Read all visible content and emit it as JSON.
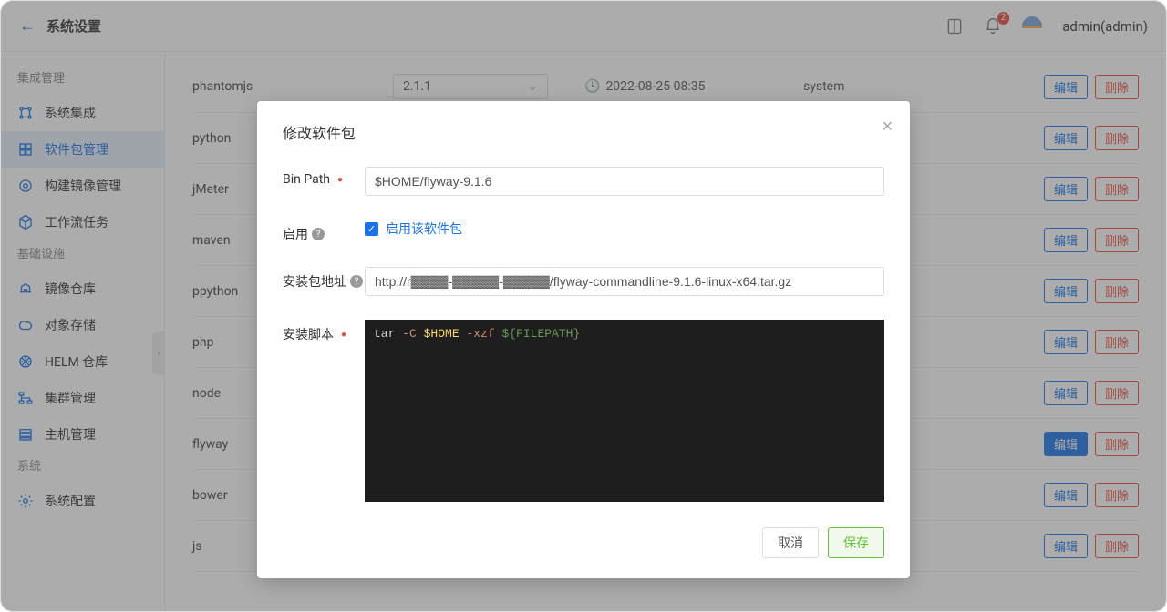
{
  "header": {
    "title": "系统设置",
    "notification_count": "2",
    "username": "admin(admin)"
  },
  "sidebar": {
    "groups": [
      {
        "title": "集成管理",
        "items": [
          {
            "label": "系统集成",
            "icon": "integration"
          },
          {
            "label": "软件包管理",
            "icon": "package",
            "active": true
          },
          {
            "label": "构建镜像管理",
            "icon": "build-image"
          },
          {
            "label": "工作流任务",
            "icon": "workflow"
          }
        ]
      },
      {
        "title": "基础设施",
        "items": [
          {
            "label": "镜像仓库",
            "icon": "image-repo"
          },
          {
            "label": "对象存储",
            "icon": "object-store"
          },
          {
            "label": "HELM 仓库",
            "icon": "helm"
          },
          {
            "label": "集群管理",
            "icon": "cluster"
          },
          {
            "label": "主机管理",
            "icon": "host"
          }
        ]
      },
      {
        "title": "系统",
        "items": [
          {
            "label": "系统配置",
            "icon": "settings"
          }
        ]
      }
    ]
  },
  "table": {
    "edit_label": "编辑",
    "delete_label": "删除",
    "rows": [
      {
        "name": "phantomjs",
        "version": "2.1.1",
        "time": "2022-08-25 08:35",
        "user": "system"
      },
      {
        "name": "python",
        "version": "",
        "time": "",
        "user": ""
      },
      {
        "name": "jMeter",
        "version": "",
        "time": "",
        "user": ""
      },
      {
        "name": "maven",
        "version": "",
        "time": "",
        "user": ""
      },
      {
        "name": "ppython",
        "version": "",
        "time": "",
        "user": ""
      },
      {
        "name": "php",
        "version": "",
        "time": "",
        "user": ""
      },
      {
        "name": "node",
        "version": "",
        "time": "",
        "user": ""
      },
      {
        "name": "flyway",
        "version": "",
        "time": "",
        "user": "",
        "highlighted": true
      },
      {
        "name": "bower",
        "version": "",
        "time": "",
        "user": ""
      },
      {
        "name": "js",
        "version": "",
        "time": "",
        "user": ""
      }
    ]
  },
  "modal": {
    "title": "修改软件包",
    "labels": {
      "bin_path": "Bin Path",
      "enable": "启用",
      "install_url": "安装包地址",
      "install_script": "安装脚本"
    },
    "bin_path_value": "$HOME/flyway-9.1.6",
    "enable_checkbox_label": "启用该软件包",
    "install_url_value": "http://r▓▓▓▓-▓▓▓▓▓-▓▓▓▓▓/flyway-commandline-9.1.6-linux-x64.tar.gz",
    "script": {
      "cmd": "tar ",
      "flag1": "-C ",
      "home": "$HOME ",
      "flag2": "-xzf ",
      "var": "${FILEPATH}"
    },
    "cancel_label": "取消",
    "save_label": "保存"
  }
}
